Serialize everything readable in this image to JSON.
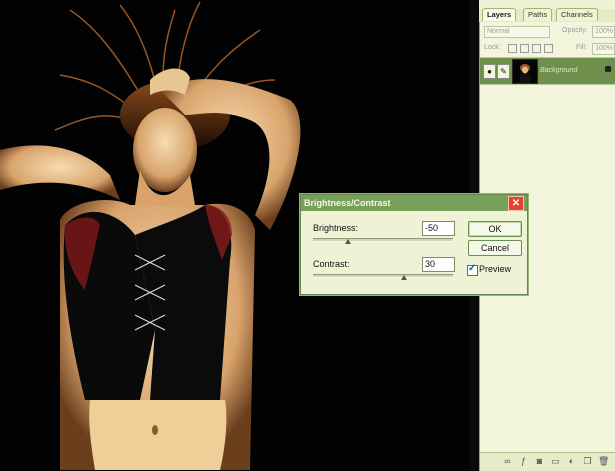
{
  "palette": {
    "tabs": [
      "Layers",
      "Paths",
      "Channels"
    ],
    "blend_mode": "Normal",
    "opacity_label": "Opacity:",
    "opacity_value": "100%",
    "lock_label": "Lock:",
    "fill_label": "Fill:",
    "fill_value": "100%",
    "layer_name": "Background"
  },
  "dialog": {
    "title": "Brightness/Contrast",
    "brightness_label": "Brightness:",
    "brightness_value": "-50",
    "brightness_level": -50,
    "contrast_label": "Contrast:",
    "contrast_value": "30",
    "contrast_level": 30,
    "ok_label": "OK",
    "cancel_label": "Cancel",
    "preview_label": "Preview",
    "preview_checked": true
  },
  "colors": {
    "panel_bg": "#f2f5dc",
    "titlebar": "#79a05a",
    "close": "#e64329",
    "layer_selected": "#6f8f4d"
  }
}
